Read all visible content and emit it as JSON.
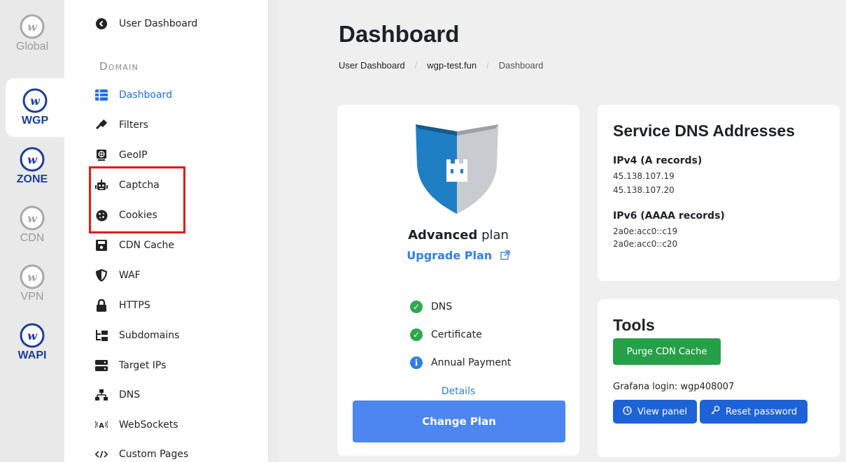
{
  "rail": [
    {
      "label": "Global",
      "style": "gray",
      "active": false
    },
    {
      "label": "WGP",
      "style": "blue",
      "active": true
    },
    {
      "label": "ZONE",
      "style": "blue",
      "active": false
    },
    {
      "label": "CDN",
      "style": "gray",
      "active": false
    },
    {
      "label": "VPN",
      "style": "gray",
      "active": false
    },
    {
      "label": "WAPI",
      "style": "blue",
      "active": false
    }
  ],
  "nav": {
    "back_label": "User Dashboard",
    "section_label": "Domain",
    "items": [
      {
        "label": "Dashboard",
        "icon": "table-icon",
        "active": true
      },
      {
        "label": "Filters",
        "icon": "gavel-icon",
        "active": false
      },
      {
        "label": "GeoIP",
        "icon": "globe-icon",
        "active": false
      },
      {
        "label": "Captcha",
        "icon": "robot-icon",
        "active": false
      },
      {
        "label": "Cookies",
        "icon": "cookie-icon",
        "active": false
      },
      {
        "label": "CDN Cache",
        "icon": "save-icon",
        "active": false
      },
      {
        "label": "WAF",
        "icon": "shield-icon",
        "active": false
      },
      {
        "label": "HTTPS",
        "icon": "lock-icon",
        "active": false
      },
      {
        "label": "Subdomains",
        "icon": "tree-icon",
        "active": false
      },
      {
        "label": "Target IPs",
        "icon": "server-icon",
        "active": false
      },
      {
        "label": "DNS",
        "icon": "network-icon",
        "active": false
      },
      {
        "label": "WebSockets",
        "icon": "broadcast-icon",
        "active": false
      },
      {
        "label": "Custom Pages",
        "icon": "code-icon",
        "active": false
      }
    ]
  },
  "header": {
    "title": "Dashboard",
    "breadcrumb": [
      "User Dashboard",
      "wgp-test.fun",
      "Dashboard"
    ]
  },
  "plan": {
    "name_bold": "Advanced",
    "name_rest": " plan",
    "upgrade_label": "Upgrade Plan",
    "features": [
      {
        "label": "DNS",
        "status": "check"
      },
      {
        "label": "Certificate",
        "status": "check"
      },
      {
        "label": "Annual Payment",
        "status": "info"
      }
    ],
    "details_label": "Details",
    "change_label": "Change Plan"
  },
  "dns": {
    "title": "Service DNS Addresses",
    "ipv4_label": "IPv4 (A records)",
    "ipv4": [
      "45.138.107.19",
      "45.138.107.20"
    ],
    "ipv6_label": "IPv6 (AAAA records)",
    "ipv6": [
      "2a0e:acc0::c19",
      "2a0e:acc0::c20"
    ]
  },
  "tools": {
    "title": "Tools",
    "purge_label": "Purge CDN Cache",
    "grafana_text": "Grafana login: wgp408007",
    "view_panel_label": "View panel",
    "reset_password_label": "Reset password"
  },
  "colors": {
    "accent": "#1e6ee8",
    "brand_blue": "#1b3e9a",
    "success": "#25a048",
    "highlight": "#e3191c"
  }
}
